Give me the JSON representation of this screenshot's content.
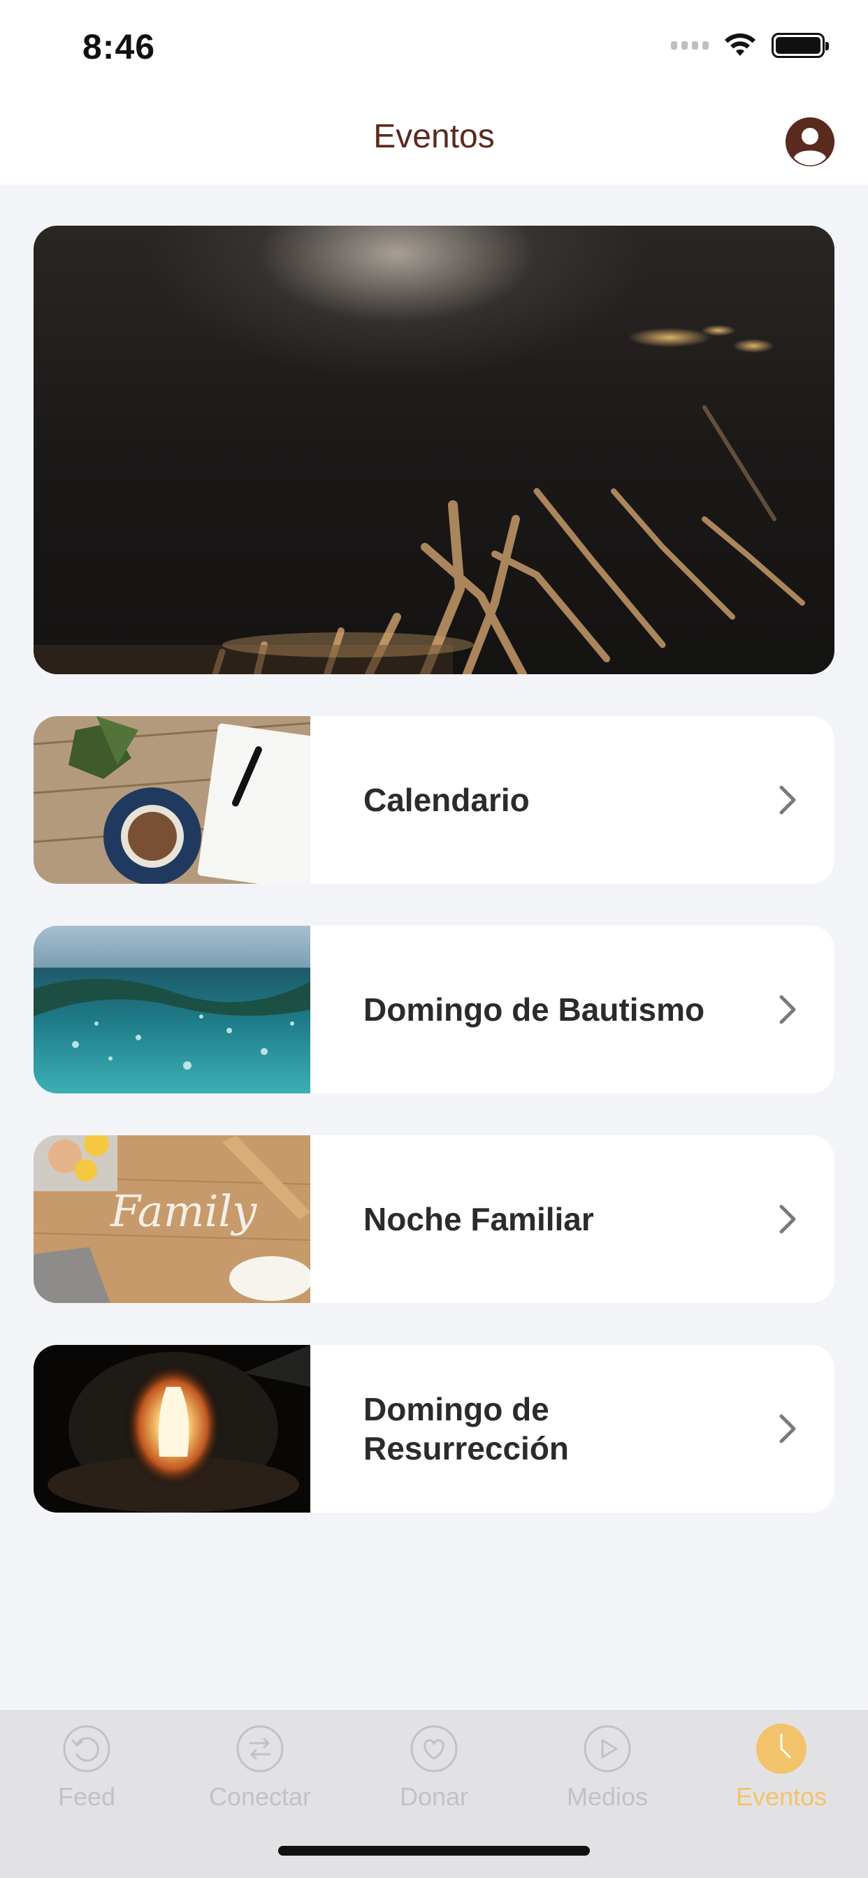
{
  "status_bar": {
    "time": "8:46"
  },
  "nav": {
    "title": "Eventos"
  },
  "events": [
    {
      "title": "Calendario",
      "thumb": "notebook-coffee"
    },
    {
      "title": "Domingo de Bautismo",
      "thumb": "water"
    },
    {
      "title": "Noche Familiar",
      "thumb": "family-flour"
    },
    {
      "title": "Domingo de Resurrección",
      "thumb": "empty-tomb"
    }
  ],
  "tabs": [
    {
      "label": "Feed",
      "icon": "refresh-icon",
      "active": false
    },
    {
      "label": "Conectar",
      "icon": "swap-arrows-icon",
      "active": false
    },
    {
      "label": "Donar",
      "icon": "heart-icon",
      "active": false
    },
    {
      "label": "Medios",
      "icon": "play-icon",
      "active": false
    },
    {
      "label": "Eventos",
      "icon": "clock-icon",
      "active": true
    }
  ],
  "colors": {
    "brand": "#5a2a1f",
    "active_tab": "#f2c36b",
    "inactive_tab": "#c2c2c4",
    "background": "#f3f4f8"
  }
}
